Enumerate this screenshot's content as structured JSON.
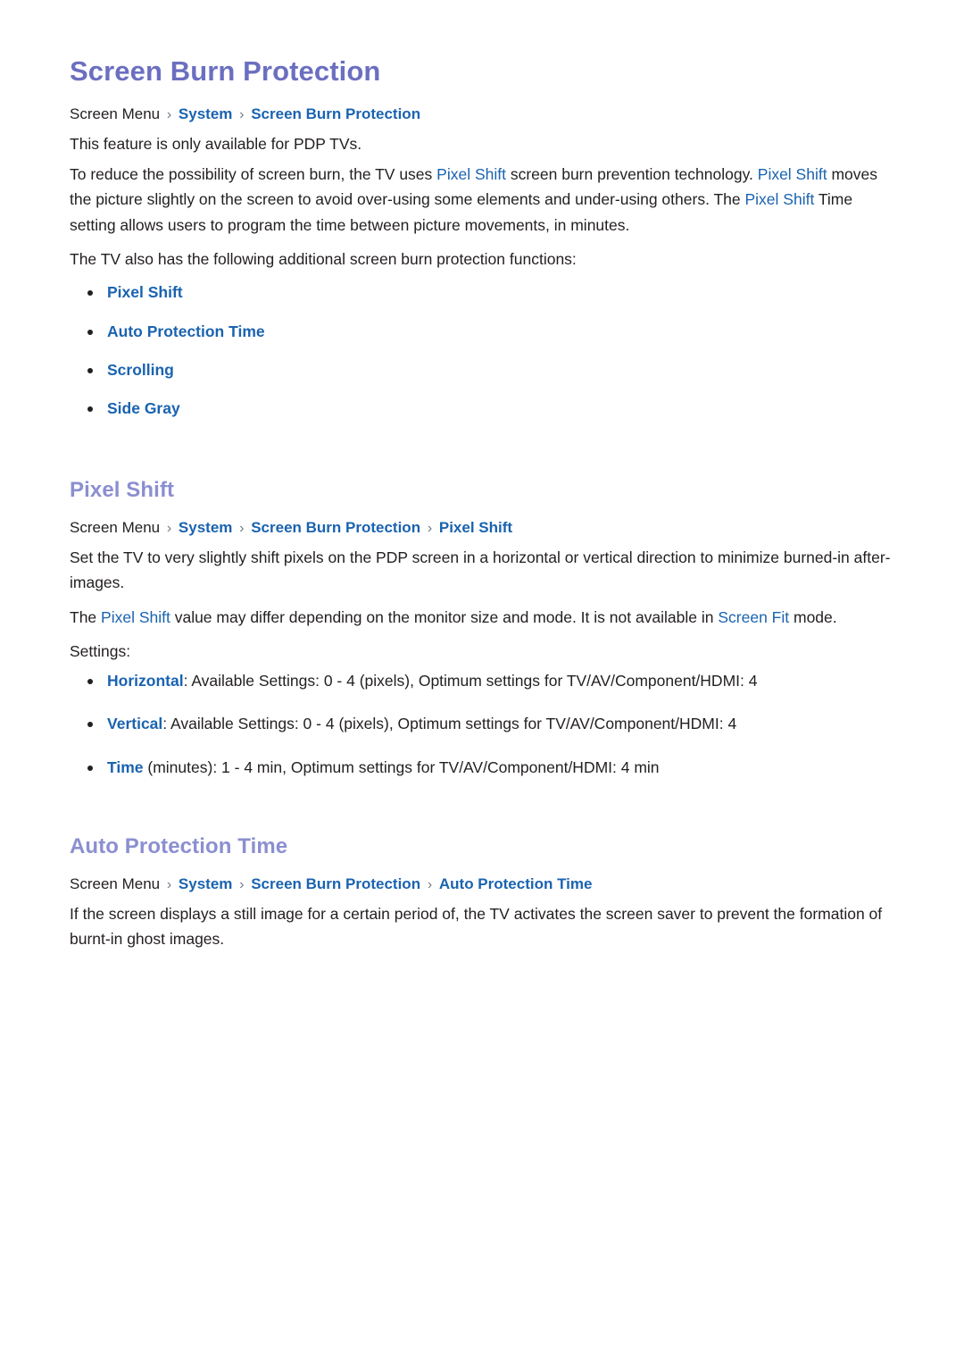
{
  "document": {
    "title": "Screen Burn Protection"
  },
  "intro": {
    "breadcrumb": {
      "root": "Screen Menu",
      "separator": "›",
      "links": [
        "System",
        "Screen Burn Protection"
      ]
    },
    "availability_note": "This feature is only available for PDP TVs.",
    "paragraph_1": {
      "part_1": "To reduce the possibility of screen burn, the TV uses ",
      "kw_1": "Pixel Shift",
      "part_2": " screen burn prevention technology. ",
      "kw_2": "Pixel Shift",
      "part_3": " moves the picture slightly on the screen to avoid over-using some elements and under-using others. The ",
      "kw_3": "Pixel Shift",
      "part_4": " Time setting allows users to program the time between picture movements, in minutes."
    },
    "paragraph_2": "The TV also has the following additional screen burn protection functions:",
    "feature_list": [
      "Pixel Shift",
      "Auto Protection Time",
      "Scrolling",
      "Side Gray"
    ]
  },
  "pixel_shift": {
    "heading": "Pixel Shift",
    "breadcrumb": {
      "root": "Screen Menu",
      "separator": "›",
      "links": [
        "System",
        "Screen Burn Protection",
        "Pixel Shift"
      ]
    },
    "paragraph_1": "Set the TV to very slightly shift pixels on the PDP screen in a horizontal or vertical direction to minimize burned-in after-images.",
    "paragraph_2": {
      "part_1": "The ",
      "kw_1": "Pixel Shift",
      "part_2": " value may differ depending on the monitor size and mode. It is not available in ",
      "kw_2": "Screen Fit",
      "part_3": " mode."
    },
    "settings_label": "Settings:",
    "settings": [
      {
        "label": "Horizontal",
        "text": ": Available Settings: 0 - 4 (pixels), Optimum settings for TV/AV/Component/HDMI: 4"
      },
      {
        "label": "Vertical",
        "text": ": Available Settings: 0 - 4 (pixels), Optimum settings for TV/AV/Component/HDMI: 4"
      },
      {
        "label": "Time",
        "text": " (minutes): 1 - 4 min, Optimum settings for TV/AV/Component/HDMI: 4 min"
      }
    ]
  },
  "auto_protection_time": {
    "heading": "Auto Protection Time",
    "breadcrumb": {
      "root": "Screen Menu",
      "separator": "›",
      "links": [
        "System",
        "Screen Burn Protection",
        "Auto Protection Time"
      ]
    },
    "paragraph_1": "If the screen displays a still image for a certain period of, the TV activates the screen saver to prevent the formation of burnt-in ghost images."
  },
  "colors": {
    "doc_title": "#6b6fc0",
    "section_title": "#8b8fd0",
    "link_blue": "#1a63b0",
    "body_text": "#231f20",
    "separator": "#6f7b88",
    "background": "#ffffff"
  }
}
